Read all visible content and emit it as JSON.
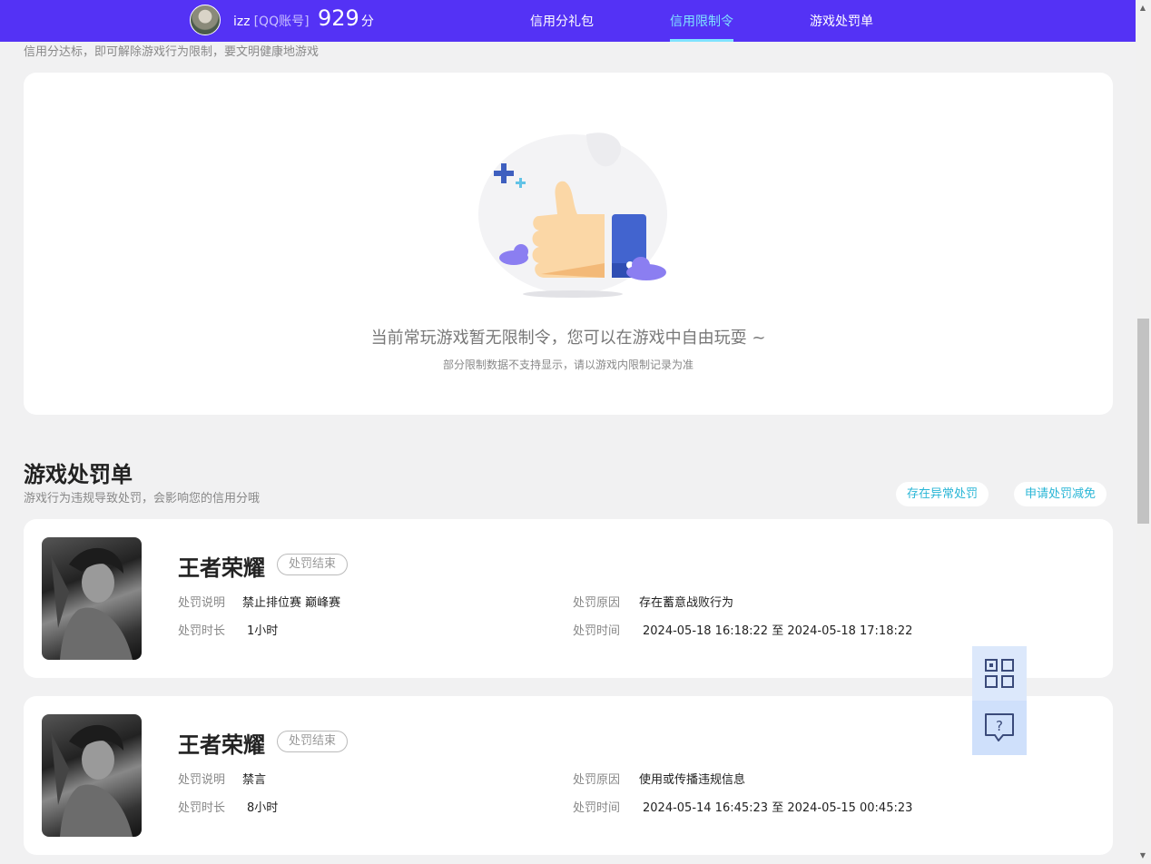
{
  "header": {
    "username": "izz",
    "account_type": "[QQ账号]",
    "score": "929",
    "score_unit": "分",
    "nav": [
      {
        "label": "信用分礼包",
        "active": false
      },
      {
        "label": "信用限制令",
        "active": true
      },
      {
        "label": "游戏处罚单",
        "active": false
      }
    ]
  },
  "restriction": {
    "subtitle": "信用分达标，即可解除游戏行为限制，要文明健康地游戏",
    "empty_title": "当前常玩游戏暂无限制令，您可以在游戏中自由玩耍 ~",
    "empty_subtitle": "部分限制数据不支持显示，请以游戏内限制记录为准"
  },
  "penalty": {
    "title": "游戏处罚单",
    "subtitle": "游戏行为违规导致处罚，会影响您的信用分哦",
    "btn_abnormal": "存在异常处罚",
    "btn_appeal": "申请处罚减免",
    "labels": {
      "desc": "处罚说明",
      "duration": "处罚时长",
      "reason": "处罚原因",
      "time": "处罚时间"
    },
    "items": [
      {
        "game": "王者荣耀",
        "status": "处罚结束",
        "desc": "禁止排位赛 巅峰赛",
        "duration": "1小时",
        "reason": "存在蓄意战败行为",
        "time": "2024-05-18 16:18:22 至 2024-05-18 17:18:22"
      },
      {
        "game": "王者荣耀",
        "status": "处罚结束",
        "desc": "禁言",
        "duration": "8小时",
        "reason": "使用或传播违规信息",
        "time": "2024-05-14 16:45:23 至 2024-05-15 00:45:23"
      }
    ]
  },
  "float": {
    "qr_icon": "qr-code-icon",
    "help_icon": "help-chat-icon",
    "help_glyph": "?"
  },
  "colors": {
    "header_bg": "#5432f5",
    "accent_active": "#7fe3ff",
    "pill_text": "#29b6d6"
  }
}
